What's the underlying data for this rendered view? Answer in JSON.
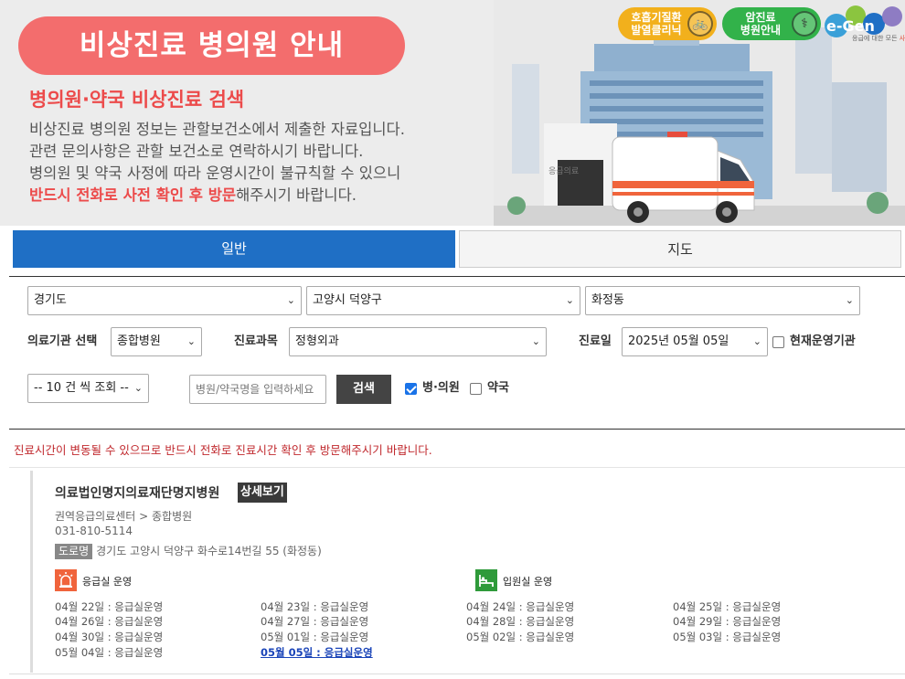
{
  "banner": {
    "title": "비상진료 병의원 안내",
    "subtitle": "병의원·약국 비상진료 검색",
    "desc_line1": "비상진료 병의원 정보는 관할보건소에서 제출한 자료입니다.",
    "desc_line2": "관련 문의사항은 관할 보건소로 연락하시기 바랍니다.",
    "desc_line3": "병의원 및 약국 사정에 따라 운영시간이 불규칙할 수 있으니",
    "desc_line4_red": "반드시 전화로 사전 확인 후 방문",
    "desc_line4_rest": "해주시기 바랍니다.",
    "pill1_line1": "호흡기질환",
    "pill1_line2": "발열클리닉",
    "pill1_icon": "bicycle-icon",
    "pill2_line1": "암진료",
    "pill2_line2": "병원안내",
    "pill2_icon": "stethoscope-icon",
    "logo_text": "e-Gen",
    "logo_sub_plain": "응급에 대한 모든 ",
    "logo_sub_red": "사랑",
    "ambulance_text": "응급의료"
  },
  "tabs": {
    "general": "일반",
    "map": "지도"
  },
  "search": {
    "region_province": "경기도",
    "region_city": "고양시 덕양구",
    "region_dong": "화정동",
    "institution_label": "의료기관 선택",
    "institution_value": "종합병원",
    "dept_label": "진료과목",
    "dept_value": "정형외과",
    "date_label": "진료일",
    "date_value": "2025년 05월 05일",
    "open_now_label": "현재운영기관",
    "open_now_checked": false,
    "page_size": "-- 10 건 씩 조회 --",
    "keyword_placeholder": "병원/약국명을 입력하세요",
    "search_button": "검색",
    "clinic_label": "병·의원",
    "clinic_checked": true,
    "pharmacy_label": "약국",
    "pharmacy_checked": false
  },
  "notice": "진료시간이 변동될 수 있으므로 반드시 전화로 진료시간 확인 후 방문해주시기 바랍니다.",
  "result": {
    "name": "의료법인명지의료재단명지병원",
    "detail_button": "상세보기",
    "category": "권역응급의료센터 > 종합병원",
    "phone": "031-810-5114",
    "road_tag": "도로명",
    "address": "경기도 고양시 덕양구 화수로14번길 55 (화정동)",
    "er_label": "응급실 운영",
    "er_icon": "siren-icon",
    "ward_label": "입원실 운영",
    "ward_icon": "bed-icon",
    "er_color": "#f0643c",
    "ward_color": "#2f9a3a",
    "schedule": [
      "04월 22일 : 응급실운영",
      "04월 23일 : 응급실운영",
      "04월 24일 : 응급실운영",
      "04월 25일 : 응급실운영",
      "04월 26일 : 응급실운영",
      "04월 27일 : 응급실운영",
      "04월 28일 : 응급실운영",
      "04월 29일 : 응급실운영",
      "04월 30일 : 응급실운영",
      "05월 01일 : 응급실운영",
      "05월 02일 : 응급실운영",
      "05월 03일 : 응급실운영",
      "05월 04일 : 응급실운영",
      "05월 05일 : 응급실운영"
    ]
  }
}
